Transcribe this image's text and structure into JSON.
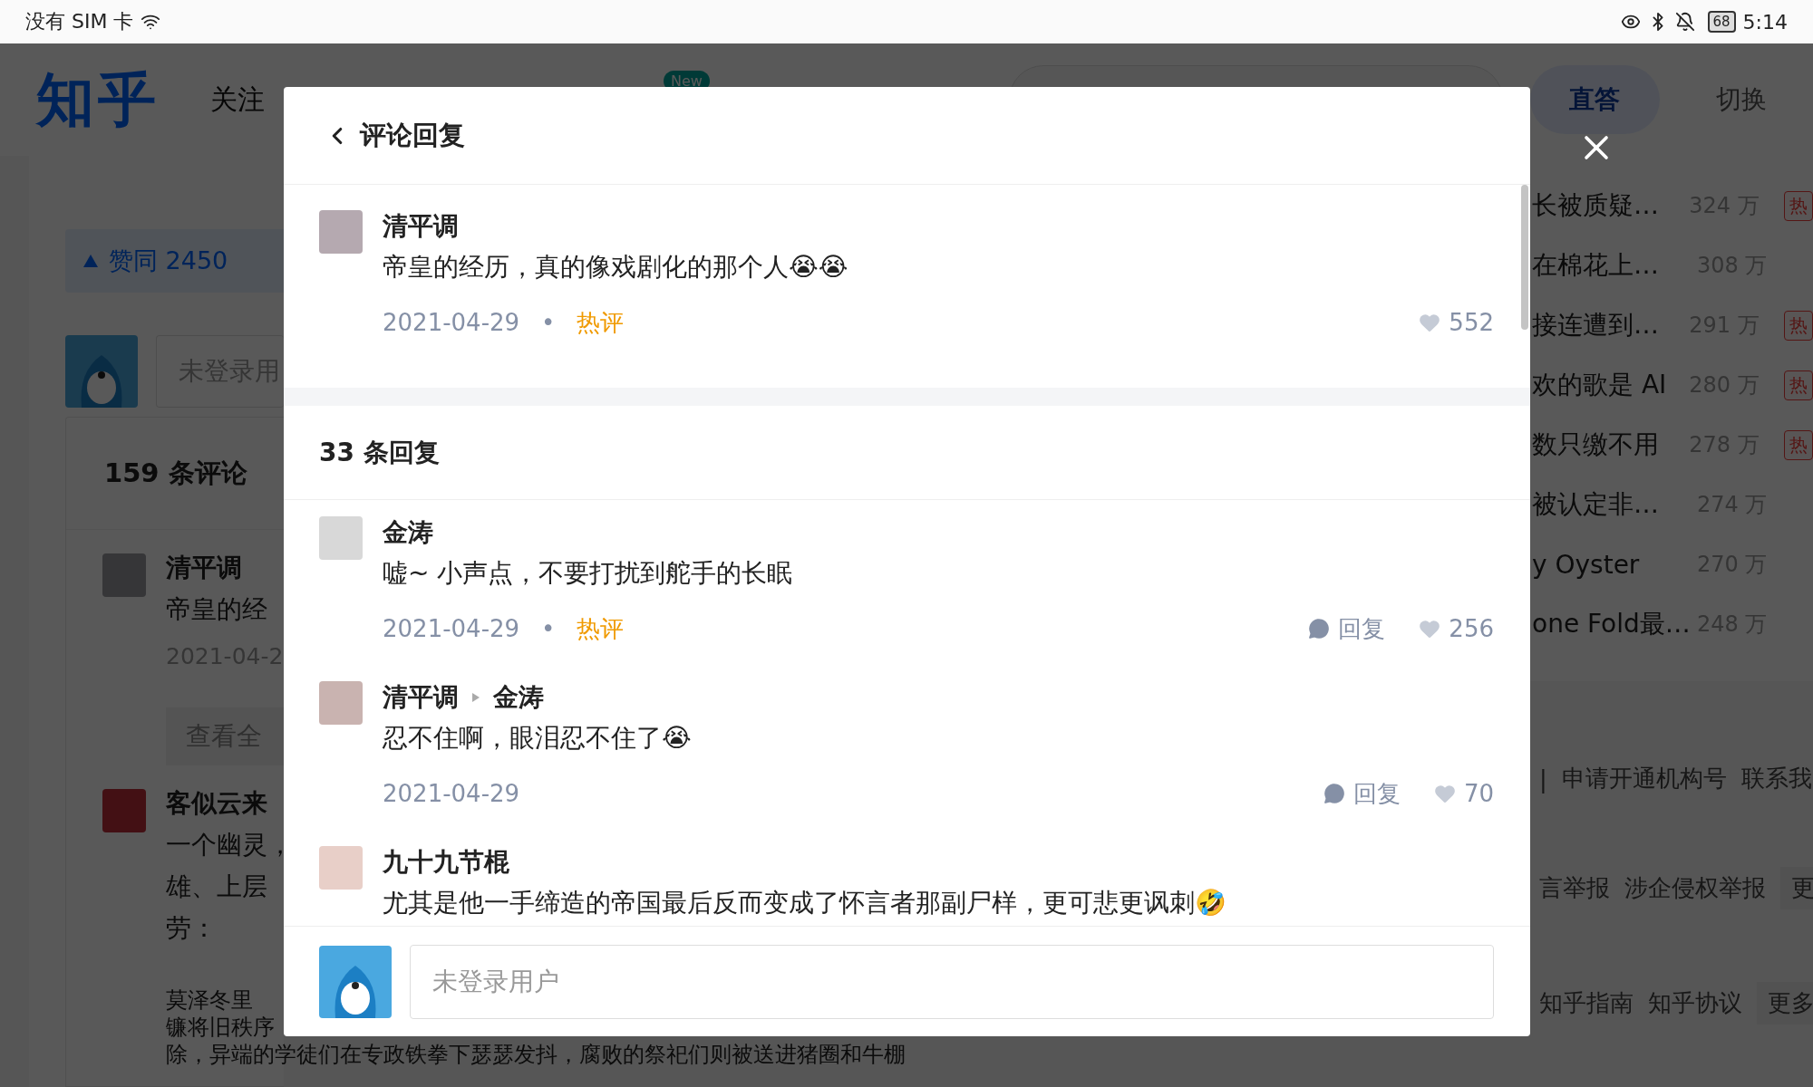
{
  "status_bar": {
    "carrier": "没有 SIM 卡",
    "battery": "68",
    "time": "5:14"
  },
  "header": {
    "logo": "知乎",
    "nav": [
      {
        "label": "关注",
        "selected": false
      }
    ],
    "new_badge": "New",
    "ask_button": "直答",
    "switch_link": "切换"
  },
  "article": {
    "vote_button": "赞同 2450",
    "comment_input": {
      "placeholder": "未登录用"
    },
    "comment_count": "159 条评论",
    "comments": [
      {
        "author": "清平调",
        "lines": [
          "帝皇的经"
        ],
        "date": "2021-04-2",
        "view_all": "查看全"
      },
      {
        "author": "客似云来",
        "lines": [
          "一个幽灵，",
          "雄、上层",
          "劳："
        ]
      }
    ],
    "paragraph": [
      "莫泽冬里",
      "镰将旧秩序",
      "除，异端的学徒们在专政铁拳下瑟瑟发抖，腐败的祭祀们则被送进猪圈和牛棚"
    ]
  },
  "hot_list": [
    {
      "title": "长被质疑…",
      "count": "324 万",
      "badge": "热"
    },
    {
      "title": "在棉花上…",
      "count": "308 万"
    },
    {
      "title": "接连遭到…",
      "count": "291 万",
      "badge": "热"
    },
    {
      "title": "欢的歌是 AI",
      "count": "280 万",
      "badge": "热"
    },
    {
      "title": "数只缴不用",
      "count": "278 万",
      "badge": "热"
    },
    {
      "title": "被认定非…",
      "count": "274 万"
    },
    {
      "title": "y Oyster",
      "count": "270 万"
    },
    {
      "title": "one Fold最…",
      "count": "248 万"
    }
  ],
  "footer_links": [
    [
      "|",
      "申请开通机构号",
      "联系我"
    ],
    [
      "言举报",
      "涉企侵权举报",
      "更"
    ],
    [
      "知乎指南",
      "知乎协议",
      "更多"
    ]
  ],
  "dialog": {
    "title": "评论回复",
    "root_comment": {
      "author": "清平调",
      "text": "帝皇的经历，真的像戏剧化的那个人😭😭",
      "date": "2021-04-29",
      "separator": "•",
      "tag": "热评",
      "likes": "552"
    },
    "reply_count": "33 条回复",
    "replies": [
      {
        "author": "金涛",
        "text": "嘘~  小声点，不要打扰到舵手的长眠",
        "date": "2021-04-29",
        "separator": "•",
        "tag": "热评",
        "reply_label": "回复",
        "likes": "256"
      },
      {
        "author": "清平调",
        "reply_to": "金涛",
        "text": "忍不住啊，眼泪忍不住了😭",
        "date": "2021-04-29",
        "reply_label": "回复",
        "likes": "70"
      },
      {
        "author": "九十九节棍",
        "text": "尤其是他一手缔造的帝国最后反而变成了怀言者那副尸样，更可悲更讽刺🤣"
      }
    ],
    "input": {
      "placeholder": "未登录用户"
    }
  }
}
